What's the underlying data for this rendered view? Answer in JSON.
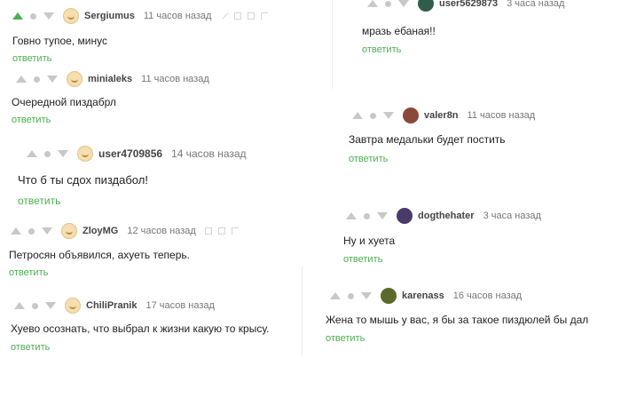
{
  "reply_label": "ответить",
  "colors": {
    "accent": "#4caf50",
    "muted": "#c8c8c8"
  },
  "comments": [
    {
      "username": "Sergiumus",
      "time": "11 часов назад",
      "text": "Говно тупое, минус"
    },
    {
      "username": "minialeks",
      "time": "11 часов назад",
      "text": "Очередной пиздабрл"
    },
    {
      "username": "user4709856",
      "time": "14 часов назад",
      "text": "Что б ты сдох пиздабол!"
    },
    {
      "username": "ZloyMG",
      "time": "12 часов назад",
      "text": "Петросян объявился, ахуеть теперь."
    },
    {
      "username": "ChiliPranik",
      "time": "17 часов назад",
      "text": "Хуево осознать, что выбрал к жизни какую то крысу."
    },
    {
      "username": "user5629873",
      "time": "3 часа назад",
      "text": "мразь ебаная!!"
    },
    {
      "username": "valer8n",
      "time": "11 часов назад",
      "text": "Завтра медальки будет постить"
    },
    {
      "username": "dogthehater",
      "time": "3 часа назад",
      "text": "Ну и хуета"
    },
    {
      "username": "karenass",
      "time": "16 часов назад",
      "text": "Жена то мышь у вас, я бы за такое пиздюлей бы дал"
    }
  ]
}
